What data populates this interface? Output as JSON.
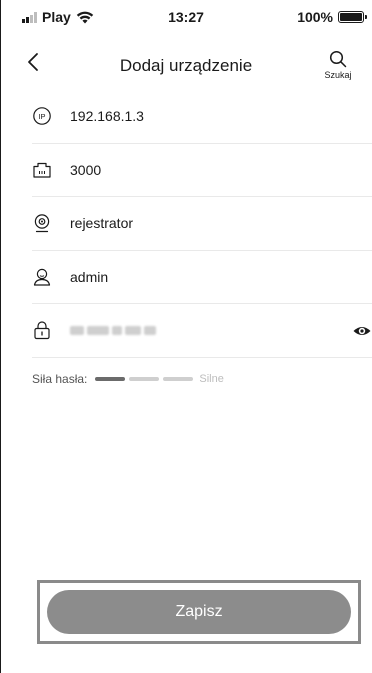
{
  "status_bar": {
    "carrier": "Play",
    "time": "13:27",
    "battery": "100%"
  },
  "header": {
    "title": "Dodaj urządzenie",
    "search_label": "Szukaj",
    "back_icon": "chevron-left-icon",
    "search_icon": "search-icon"
  },
  "form": {
    "ip": "192.168.1.3",
    "port": "3000",
    "name": "rejestrator",
    "username": "admin"
  },
  "icons": {
    "ip": "ip-icon",
    "port": "port-icon",
    "name": "camera-icon",
    "user": "user-icon",
    "password": "lock-icon",
    "reveal": "eye-icon"
  },
  "password_strength": {
    "label": "Siła hasła:",
    "level": "Silne",
    "filled_segments": 1,
    "total_segments": 3
  },
  "actions": {
    "save_label": "Zapisz"
  },
  "colors": {
    "button": "#8c8c8c",
    "strength_active": "#6b6b6b",
    "strength_inactive": "#cfcfcf",
    "divider": "#e9e9e9"
  }
}
